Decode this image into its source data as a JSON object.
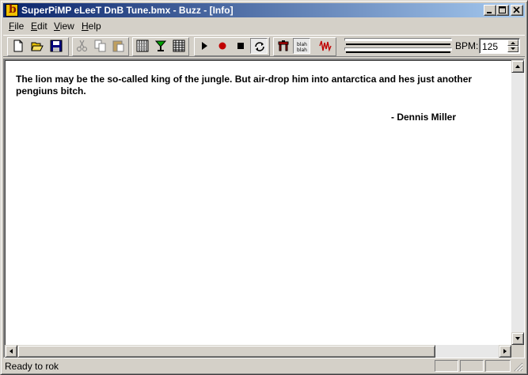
{
  "window": {
    "title": "SuperPiMP eLeeT DnB Tune.bmx - Buzz - [Info]",
    "app_icon": "b",
    "controls": [
      "minimize-icon",
      "maximize-icon",
      "close-icon"
    ]
  },
  "menu": [
    {
      "label": "File",
      "mnemonic": "F",
      "rest": "ile"
    },
    {
      "label": "Edit",
      "mnemonic": "E",
      "rest": "dit"
    },
    {
      "label": "View",
      "mnemonic": "V",
      "rest": "iew"
    },
    {
      "label": "Help",
      "mnemonic": "H",
      "rest": "elp"
    }
  ],
  "toolbar": {
    "buttons": [
      "new-icon",
      "open-icon",
      "save-icon",
      "cut-icon",
      "copy-icon",
      "paste-icon",
      "pattern-editor-icon",
      "machines-icon",
      "sequence-editor-icon",
      "play-icon",
      "record-icon",
      "stop-icon",
      "loop-icon",
      "machine-parameters-icon",
      "info-icon",
      "wave-table-icon"
    ],
    "bpm_label": "BPM:",
    "bpm_value": "125"
  },
  "info": {
    "quote": "The lion may be the so-called king of the jungle.  But air-drop him into antarctica and hes just another pengiuns bitch.",
    "attribution": "- Dennis Miller"
  },
  "status": {
    "text": "Ready to rok"
  },
  "colors": {
    "title_start": "#0a246a",
    "title_end": "#a6caf0",
    "face": "#d4d0c8",
    "record_red": "#c00000"
  }
}
